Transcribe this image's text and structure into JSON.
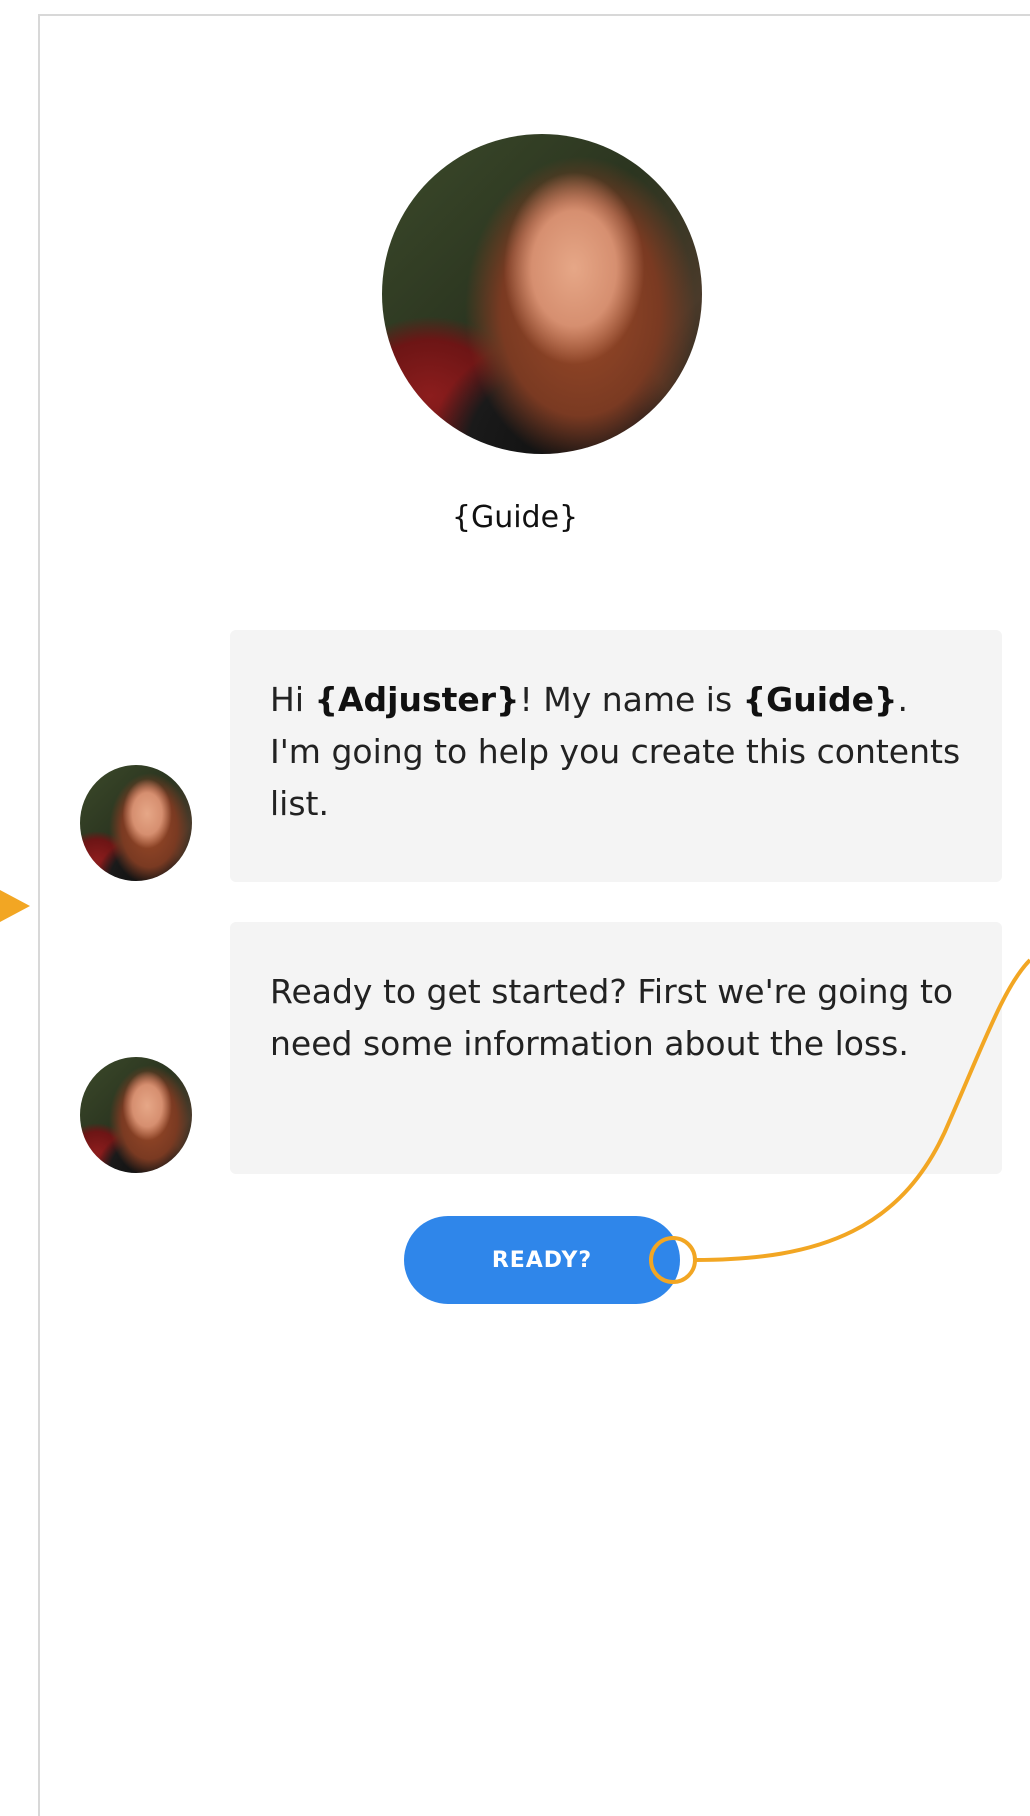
{
  "guide": {
    "name": "{Guide}"
  },
  "messages": [
    {
      "parts": [
        {
          "text": "Hi ",
          "bold": false
        },
        {
          "text": "{Adjuster}",
          "bold": true
        },
        {
          "text": "! My name is ",
          "bold": false
        },
        {
          "text": "{Guide}",
          "bold": true
        },
        {
          "text": ". I'm going to help you create this contents list.",
          "bold": false
        }
      ]
    },
    {
      "parts": [
        {
          "text": "Ready to get started? First we're going to need some information about the loss.",
          "bold": false
        }
      ]
    }
  ],
  "ready_button": {
    "label": "READY?"
  },
  "colors": {
    "accent": "#2f86ea",
    "connector": "#f2a623",
    "bubble_bg": "#f4f4f4",
    "border": "#d8d8d8"
  }
}
